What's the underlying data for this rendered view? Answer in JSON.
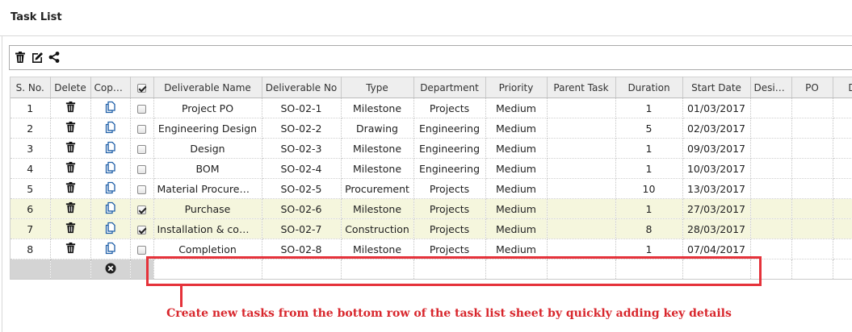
{
  "panel": {
    "title": "Task List"
  },
  "toolbar": {
    "icons": [
      "trash-icon",
      "edit-icon",
      "share-icon"
    ]
  },
  "table": {
    "columns": [
      "S. No.",
      "Delete",
      "Copy...",
      "",
      "Deliverable Name",
      "Deliverable No",
      "Type",
      "Department",
      "Priority",
      "Parent Task",
      "Duration",
      "Start Date",
      "Desig...",
      "PO",
      "Deli"
    ],
    "rows": [
      {
        "sno": "1",
        "name": "Project PO",
        "no": "SO-02-1",
        "type": "Milestone",
        "dept": "Projects",
        "priority": "Medium",
        "parent": "",
        "duration": "1",
        "start": "01/03/2017",
        "checked": false
      },
      {
        "sno": "2",
        "name": "Engineering Design",
        "no": "SO-02-2",
        "type": "Drawing",
        "dept": "Engineering",
        "priority": "Medium",
        "parent": "",
        "duration": "5",
        "start": "02/03/2017",
        "checked": false
      },
      {
        "sno": "3",
        "name": "Design",
        "no": "SO-02-3",
        "type": "Milestone",
        "dept": "Engineering",
        "priority": "Medium",
        "parent": "",
        "duration": "1",
        "start": "09/03/2017",
        "checked": false
      },
      {
        "sno": "4",
        "name": "BOM",
        "no": "SO-02-4",
        "type": "Milestone",
        "dept": "Engineering",
        "priority": "Medium",
        "parent": "",
        "duration": "1",
        "start": "10/03/2017",
        "checked": false
      },
      {
        "sno": "5",
        "name": "Material Procurem...",
        "no": "SO-02-5",
        "type": "Procurement",
        "dept": "Projects",
        "priority": "Medium",
        "parent": "",
        "duration": "10",
        "start": "13/03/2017",
        "checked": false
      },
      {
        "sno": "6",
        "name": "Purchase",
        "no": "SO-02-6",
        "type": "Milestone",
        "dept": "Projects",
        "priority": "Medium",
        "parent": "",
        "duration": "1",
        "start": "27/03/2017",
        "checked": true
      },
      {
        "sno": "7",
        "name": "Installation & com...",
        "no": "SO-02-7",
        "type": "Construction",
        "dept": "Projects",
        "priority": "Medium",
        "parent": "",
        "duration": "8",
        "start": "28/03/2017",
        "checked": true
      },
      {
        "sno": "8",
        "name": "Completion",
        "no": "SO-02-8",
        "type": "Milestone",
        "dept": "Projects",
        "priority": "Medium",
        "parent": "",
        "duration": "1",
        "start": "07/04/2017",
        "checked": false
      }
    ]
  },
  "annotation": {
    "text": "Create new tasks from the bottom row of the task list sheet by quickly adding key details"
  },
  "colors": {
    "accent": "#e5323a",
    "selected_row": "#f5f6dd",
    "header_bg": "#eeeeee",
    "new_row_grey": "#d4d4d4"
  }
}
